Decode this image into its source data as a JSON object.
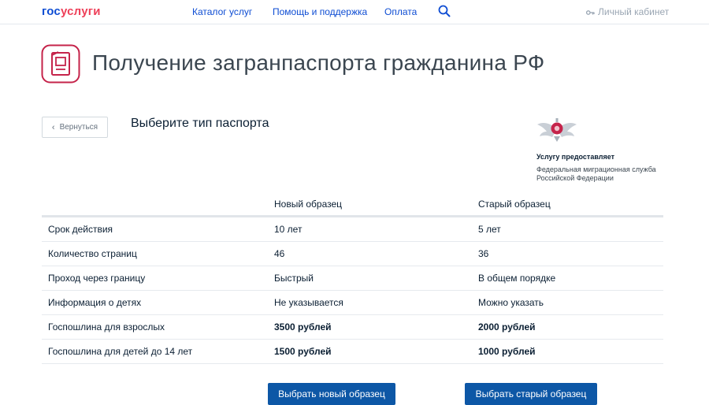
{
  "header": {
    "logo_part1": "гос",
    "logo_part2": "услуги",
    "nav": [
      "Каталог услуг",
      "Помощь и поддержка",
      "Оплата"
    ],
    "cabinet_label": "Личный кабинет"
  },
  "page": {
    "title": "Получение загранпаспорта гражданина РФ",
    "back_label": "Вернуться",
    "subtitle": "Выберите тип паспорта"
  },
  "provider": {
    "label": "Услугу предоставляет",
    "name_line1": "Федеральная миграционная служба",
    "name_line2": "Российской Федерации"
  },
  "table": {
    "headers": [
      "",
      "Новый образец",
      "Старый образец"
    ],
    "rows": [
      {
        "label": "Срок действия",
        "new": "10 лет",
        "old": "5 лет",
        "bold": false
      },
      {
        "label": "Количество страниц",
        "new": "46",
        "old": "36",
        "bold": false
      },
      {
        "label": "Проход через границу",
        "new": "Быстрый",
        "old": "В общем порядке",
        "bold": false
      },
      {
        "label": "Информация о детях",
        "new": "Не указывается",
        "old": "Можно указать",
        "bold": false
      },
      {
        "label": "Госпошлина для взрослых",
        "new": "3500 рублей",
        "old": "2000 рублей",
        "bold": true
      },
      {
        "label": "Госпошлина для детей до 14 лет",
        "new": "1500 рублей",
        "old": "1000 рублей",
        "bold": true
      }
    ]
  },
  "actions": {
    "select_new": "Выбрать новый образец",
    "select_old": "Выбрать старый образец"
  },
  "colors": {
    "brand_blue": "#0d4cd3",
    "brand_red": "#ee3f58",
    "button_blue": "#0d57a6",
    "icon_accent": "#c5234a"
  }
}
